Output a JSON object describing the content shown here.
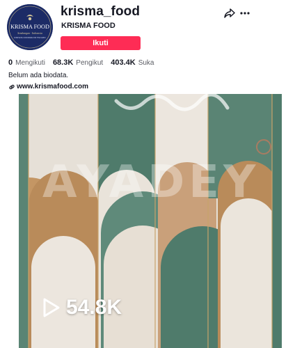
{
  "profile": {
    "username": "krisma_food",
    "nickname": "KRISMA FOOD",
    "follow_label": "Ikuti",
    "bio": "Belum ada biodata.",
    "link": "www.krismafood.com",
    "avatar_text": "KRISMA FOOD",
    "avatar_tagline": "Sembungan · Indonesia",
    "avatar_subline": "COMPLETE COOKWARE FOR THE FAMILY"
  },
  "stats": [
    {
      "value": "0",
      "label": "Mengikuti"
    },
    {
      "value": "68.3K",
      "label": "Pengikut"
    },
    {
      "value": "403.4K",
      "label": "Suka"
    }
  ],
  "video": {
    "views": "54.8K",
    "watermark": "AYADEY"
  },
  "icons": {
    "share": "share-icon",
    "more": "more-icon",
    "link": "link-icon",
    "play": "play-icon"
  },
  "colors": {
    "follow_button": "#fe2c55",
    "avatar_bg": "#1c2b66",
    "green": "#4f7b6b",
    "gold": "#b98b5a",
    "cream": "#e9e3da"
  }
}
